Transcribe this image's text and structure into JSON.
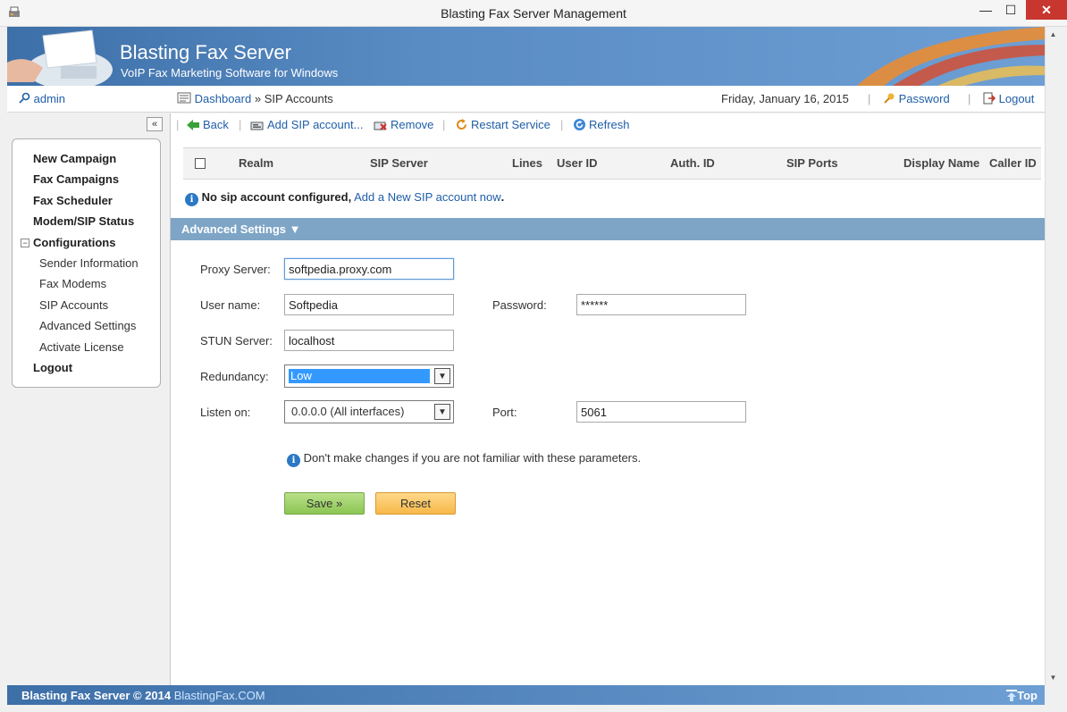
{
  "window": {
    "title": "Blasting Fax Server Management",
    "min": "—",
    "max": "☐",
    "close": "✕"
  },
  "banner": {
    "brand": "Blasting Fax Server",
    "tagline": "VoIP Fax Marketing Software for Windows"
  },
  "topnav": {
    "user": "admin",
    "breadcrumb_root": "Dashboard",
    "breadcrumb_sep": "»",
    "breadcrumb_current": "SIP Accounts",
    "date": "Friday, January 16, 2015",
    "password": "Password",
    "logout": "Logout",
    "sep": "|"
  },
  "sidebar": {
    "collapse": "«",
    "items": [
      {
        "label": "New Campaign"
      },
      {
        "label": "Fax Campaigns"
      },
      {
        "label": "Fax Scheduler"
      },
      {
        "label": "Modem/SIP Status"
      },
      {
        "label": "Configurations"
      },
      {
        "label": "Logout"
      }
    ],
    "sub_items": [
      {
        "label": "Sender Information"
      },
      {
        "label": "Fax Modems"
      },
      {
        "label": "SIP Accounts"
      },
      {
        "label": "Advanced Settings"
      },
      {
        "label": "Activate License"
      }
    ],
    "tree_toggle": "−"
  },
  "toolbar": {
    "back": "Back",
    "add": "Add SIP account...",
    "remove": "Remove",
    "restart": "Restart Service",
    "refresh": "Refresh",
    "sep": "|"
  },
  "grid": {
    "columns": [
      "Realm",
      "SIP Server",
      "Lines",
      "User ID",
      "Auth. ID",
      "SIP Ports",
      "Display Name",
      "Caller ID"
    ]
  },
  "notice": {
    "bold_text": "No sip account configured,",
    "link_text": "Add a New SIP account now",
    "suffix": ".",
    "icon": "i"
  },
  "advanced": {
    "title": "Advanced Settings ▼",
    "proxy_label": "Proxy Server:",
    "proxy_value": "softpedia.proxy.com",
    "username_label": "User name:",
    "username_value": "Softpedia",
    "password_label": "Password:",
    "password_value": "******",
    "stun_label": "STUN Server:",
    "stun_value": "localhost",
    "redundancy_label": "Redundancy:",
    "redundancy_value": "Low",
    "listen_label": "Listen on:",
    "listen_value": "0.0.0.0 (All interfaces)",
    "port_label": "Port:",
    "port_value": "5061",
    "hint": "Don't make changes if you are not familiar with these parameters.",
    "hint_icon": "i",
    "save": "Save »",
    "reset": "Reset",
    "select_arrow": "▼"
  },
  "scrollbar": {
    "up": "▲",
    "down": "▼"
  },
  "footer": {
    "copyright": "Blasting Fax Server © 2014",
    "link": "BlastingFax.COM",
    "top": "Top"
  },
  "colors": {
    "accent": "#1f5ea8",
    "banner": "#3d6fa8",
    "section_bar": "#7ea5c6",
    "save": "#8cc653",
    "reset": "#f7b84a"
  }
}
